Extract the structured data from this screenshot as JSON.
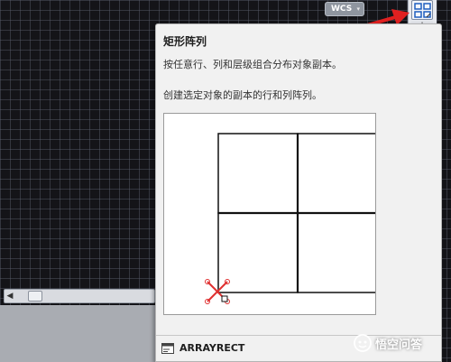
{
  "canvas": {
    "background": "#141418",
    "grid_color": "#5a5f6e"
  },
  "wcs": {
    "label": "WCS",
    "caret": "▾"
  },
  "toolbar": {
    "array_button_icon": "rectangular-array-icon",
    "plus_label": "+"
  },
  "tooltip": {
    "title": "矩形阵列",
    "description": "按任意行、列和层级组合分布对象副本。",
    "detail": "创建选定对象的副本的行和列阵列。",
    "command": "ARRAYRECT",
    "command_icon": "command-line-icon"
  },
  "scrollbar": {
    "left_arrow": "◀"
  },
  "watermark": {
    "text": "悟空问答",
    "icon": "wukong-logo-icon"
  },
  "annotation": {
    "color": "#e02020"
  }
}
